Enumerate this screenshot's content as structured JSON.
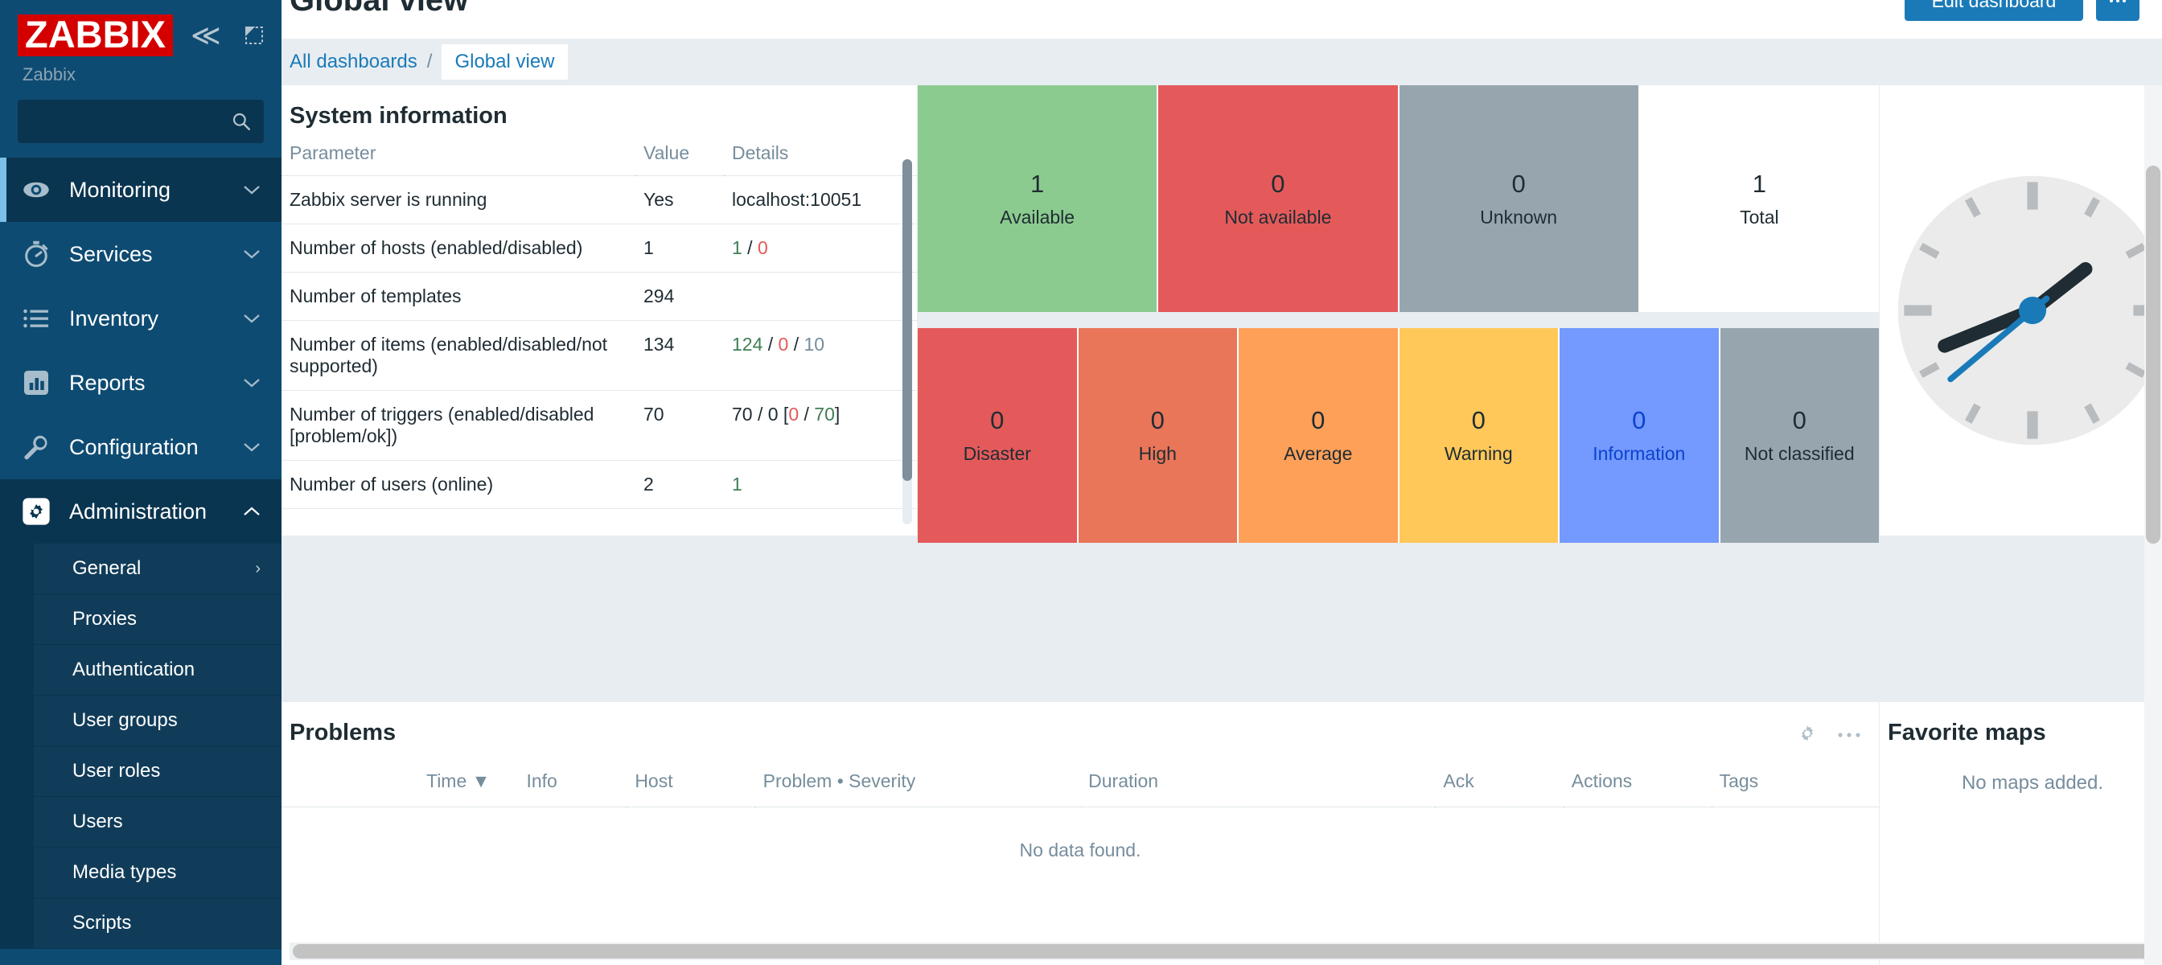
{
  "sidebar": {
    "logo_text": "ZABBIX",
    "server_name": "Zabbix",
    "search_value": "",
    "search_placeholder": "",
    "collapse_glyph": "≪",
    "pin_glyph": "↖",
    "nav": [
      {
        "label": "Monitoring",
        "icon": "eye-icon",
        "state": "active",
        "chevron": "⌄"
      },
      {
        "label": "Services",
        "icon": "stopwatch-icon",
        "state": "",
        "chevron": "⌄"
      },
      {
        "label": "Inventory",
        "icon": "list-icon",
        "state": "",
        "chevron": "⌄"
      },
      {
        "label": "Reports",
        "icon": "bar-chart-icon",
        "state": "",
        "chevron": "⌄"
      },
      {
        "label": "Configuration",
        "icon": "wrench-icon",
        "state": "",
        "chevron": "⌄"
      },
      {
        "label": "Administration",
        "icon": "gear-icon",
        "state": "open",
        "chevron": "⌃"
      }
    ],
    "submenu": [
      {
        "label": "General",
        "chevron": "›"
      },
      {
        "label": "Proxies",
        "chevron": ""
      },
      {
        "label": "Authentication",
        "chevron": ""
      },
      {
        "label": "User groups",
        "chevron": ""
      },
      {
        "label": "User roles",
        "chevron": ""
      },
      {
        "label": "Users",
        "chevron": ""
      },
      {
        "label": "Media types",
        "chevron": ""
      },
      {
        "label": "Scripts",
        "chevron": ""
      }
    ]
  },
  "header": {
    "title": "Global view",
    "edit_dashboard_label": "Edit dashboard",
    "kebab_glyph": "⋯"
  },
  "breadcrumb": {
    "root": "All dashboards",
    "separator": "/",
    "current": "Global view"
  },
  "system_information": {
    "title": "System information",
    "columns": [
      "Parameter",
      "Value",
      "Details"
    ],
    "rows": [
      {
        "parameter": "Zabbix server is running",
        "value": "Yes",
        "value_color": "green",
        "details_plain": "localhost:10051"
      },
      {
        "parameter": "Number of hosts (enabled/disabled)",
        "value": "1",
        "value_color": "dark",
        "details_parts": [
          {
            "t": "1",
            "c": "green"
          },
          {
            "t": " / ",
            "c": "dark"
          },
          {
            "t": "0",
            "c": "red"
          }
        ]
      },
      {
        "parameter": "Number of templates",
        "value": "294",
        "value_color": "dark",
        "details_plain": ""
      },
      {
        "parameter": "Number of items (enabled/disabled/not supported)",
        "value": "134",
        "value_color": "dark",
        "details_parts": [
          {
            "t": "124",
            "c": "green"
          },
          {
            "t": " / ",
            "c": "dark"
          },
          {
            "t": "0",
            "c": "red"
          },
          {
            "t": " / ",
            "c": "dark"
          },
          {
            "t": "10",
            "c": "grey"
          }
        ]
      },
      {
        "parameter": "Number of triggers (enabled/disabled [problem/ok])",
        "value": "70",
        "value_color": "dark",
        "details_parts": [
          {
            "t": "70 / 0 [",
            "c": "dark"
          },
          {
            "t": "0",
            "c": "red"
          },
          {
            "t": " / ",
            "c": "dark"
          },
          {
            "t": "70",
            "c": "green"
          },
          {
            "t": "]",
            "c": "dark"
          }
        ]
      },
      {
        "parameter": "Number of users (online)",
        "value": "2",
        "value_color": "dark",
        "details_parts": [
          {
            "t": "1",
            "c": "green"
          }
        ]
      }
    ]
  },
  "host_availability": {
    "cells": [
      {
        "count": "1",
        "label": "Available",
        "bg": "#8ccb8f",
        "fg": "#1f2c33"
      },
      {
        "count": "0",
        "label": "Not available",
        "bg": "#e45a5a",
        "fg": "#1f2c33"
      },
      {
        "count": "0",
        "label": "Unknown",
        "bg": "#97a6ae",
        "fg": "#1f2c33"
      },
      {
        "count": "1",
        "label": "Total",
        "bg": "#ffffff",
        "fg": "#1f2c33"
      }
    ]
  },
  "problems_by_severity": {
    "cells": [
      {
        "count": "0",
        "label": "Disaster",
        "bg": "#e45a5a",
        "fg": "#1f2c33"
      },
      {
        "count": "0",
        "label": "High",
        "bg": "#e97659",
        "fg": "#1f2c33"
      },
      {
        "count": "0",
        "label": "Average",
        "bg": "#ffa059",
        "fg": "#1f2c33"
      },
      {
        "count": "0",
        "label": "Warning",
        "bg": "#ffc859",
        "fg": "#1f2c33"
      },
      {
        "count": "0",
        "label": "Information",
        "bg": "#7499ff",
        "fg": "#0b43cc"
      },
      {
        "count": "0",
        "label": "Not classified",
        "bg": "#97a6ae",
        "fg": "#1f2c33"
      }
    ]
  },
  "problems": {
    "title": "Problems",
    "gear_icon": "gear-icon",
    "kebab_icon": "kebab-icon",
    "columns": [
      "Time ▼",
      "Info",
      "Host",
      "Problem • Severity",
      "Duration",
      "Ack",
      "Actions",
      "Tags"
    ],
    "empty_text": "No data found."
  },
  "favorite_maps": {
    "title": "Favorite maps",
    "empty_text": "No maps added."
  },
  "clock": {
    "hour_angle": 52,
    "minute_angle": 248,
    "second_angle": 230,
    "face_color": "#ebebeb",
    "hand_color": "#1f2c33",
    "second_color": "#1a7ab8"
  }
}
